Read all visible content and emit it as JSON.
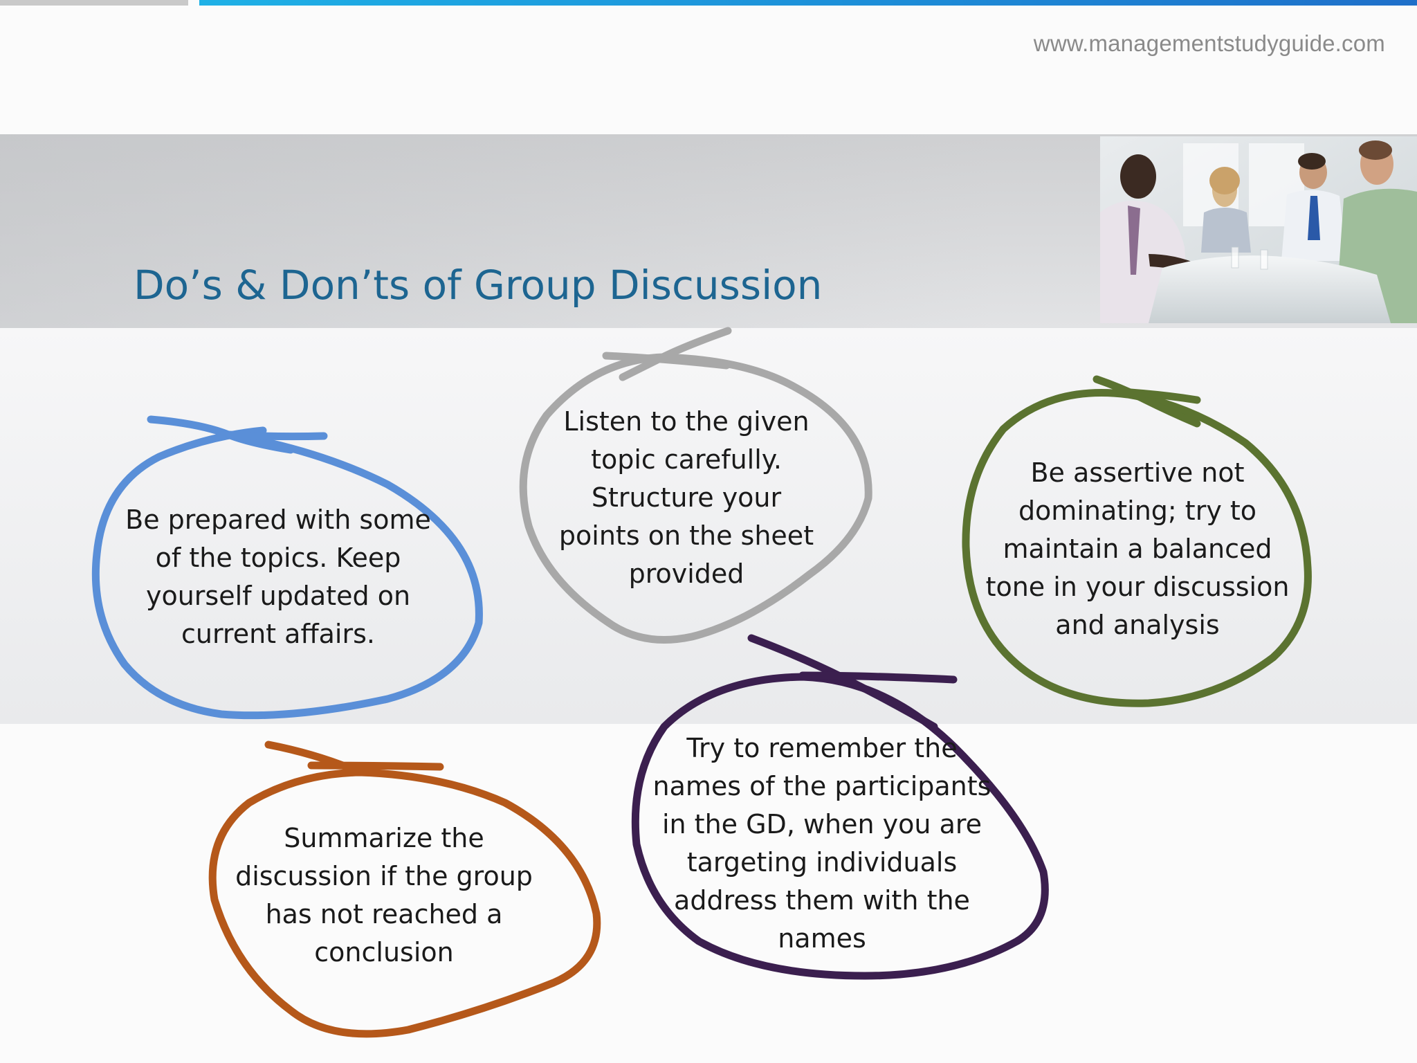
{
  "header": {
    "url": "www.managementstudyguide.com"
  },
  "title": "Do’s & Don’ts of Group Discussion",
  "photo_icon": "business-meeting-photo",
  "bubbles": [
    {
      "text": "Be prepared with some of the topics. Keep yourself updated on current affairs.",
      "color": "#5a8fd8"
    },
    {
      "text": "Listen to the given topic carefully. Structure your points on the sheet provided",
      "color": "#a8a8a8"
    },
    {
      "text": "Be assertive not dominating; try to maintain a balanced tone in your discussion and analysis",
      "color": "#5b7330"
    },
    {
      "text": "Try to remember the names of the participants in the GD, when you are targeting individuals address them with the names",
      "color": "#3b1f4f"
    },
    {
      "text": "Summarize the discussion if the group has not reached a conclusion",
      "color": "#b5581a"
    }
  ]
}
